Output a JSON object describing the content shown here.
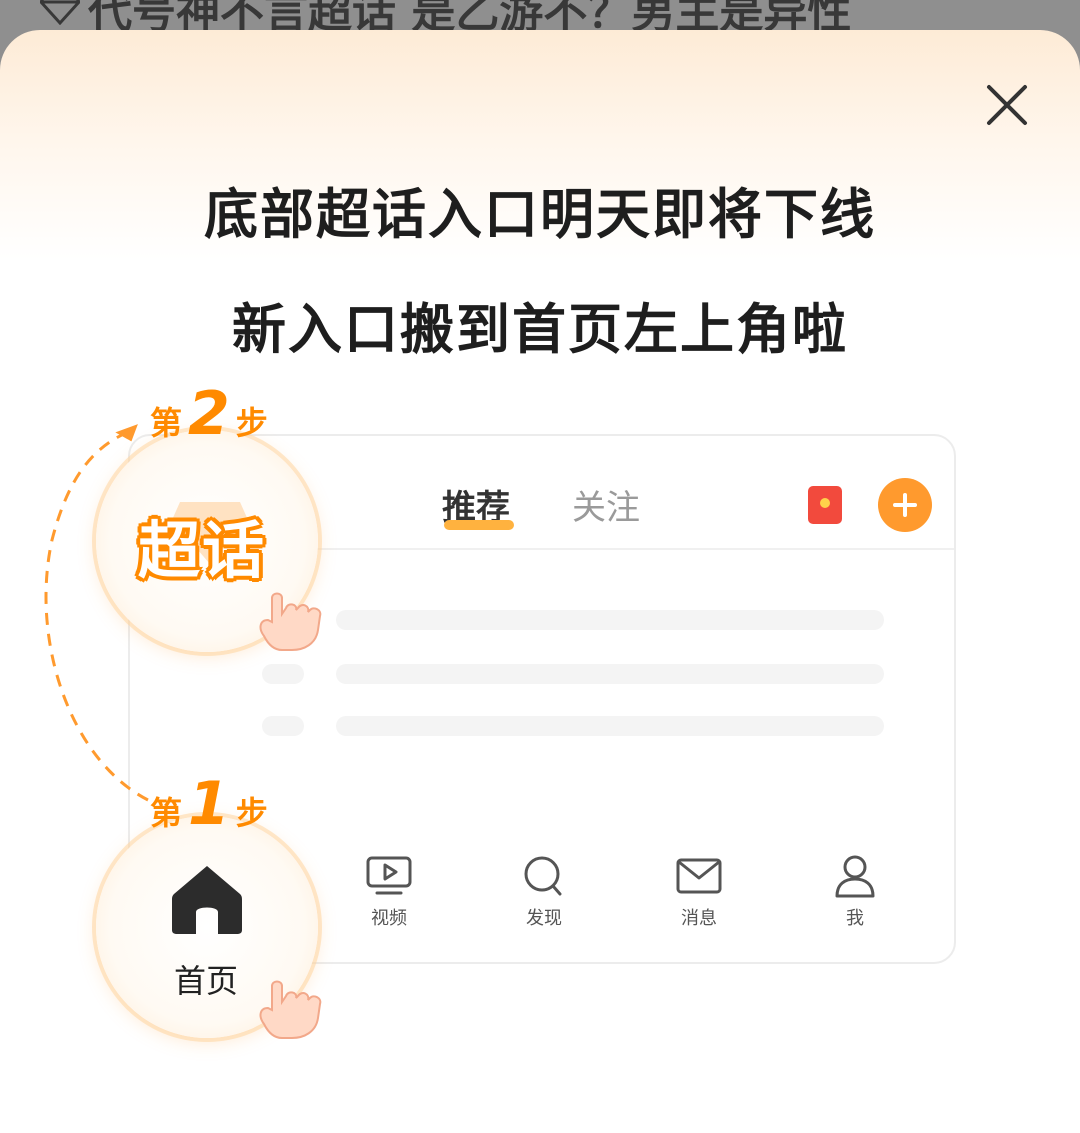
{
  "background": {
    "headline": "代号神不言超话 是乙游不？男主是异性"
  },
  "popup": {
    "title_line1": "底部超话入口明天即将下线",
    "title_line2_prefix": "新入口搬到",
    "title_line2_highlight": "首页左上角",
    "title_line2_suffix": "啦"
  },
  "steps": {
    "step2": {
      "prefix": "第",
      "number": "2",
      "suffix": "步",
      "badge_text": "超话"
    },
    "step1": {
      "prefix": "第",
      "number": "1",
      "suffix": "步",
      "badge_label": "首页"
    }
  },
  "mockup": {
    "tabs": [
      {
        "label": "推荐",
        "active": true
      },
      {
        "label": "关注",
        "active": false
      }
    ],
    "nav": [
      {
        "label": "视频",
        "icon": "video-icon"
      },
      {
        "label": "发现",
        "icon": "search-icon"
      },
      {
        "label": "消息",
        "icon": "mail-icon"
      },
      {
        "label": "我",
        "icon": "profile-icon"
      }
    ]
  },
  "colors": {
    "accent": "#ff8a00",
    "plus_button": "#ff9a2e",
    "red_packet": "#f24a3d",
    "sheet_top": "#fdebd6"
  }
}
